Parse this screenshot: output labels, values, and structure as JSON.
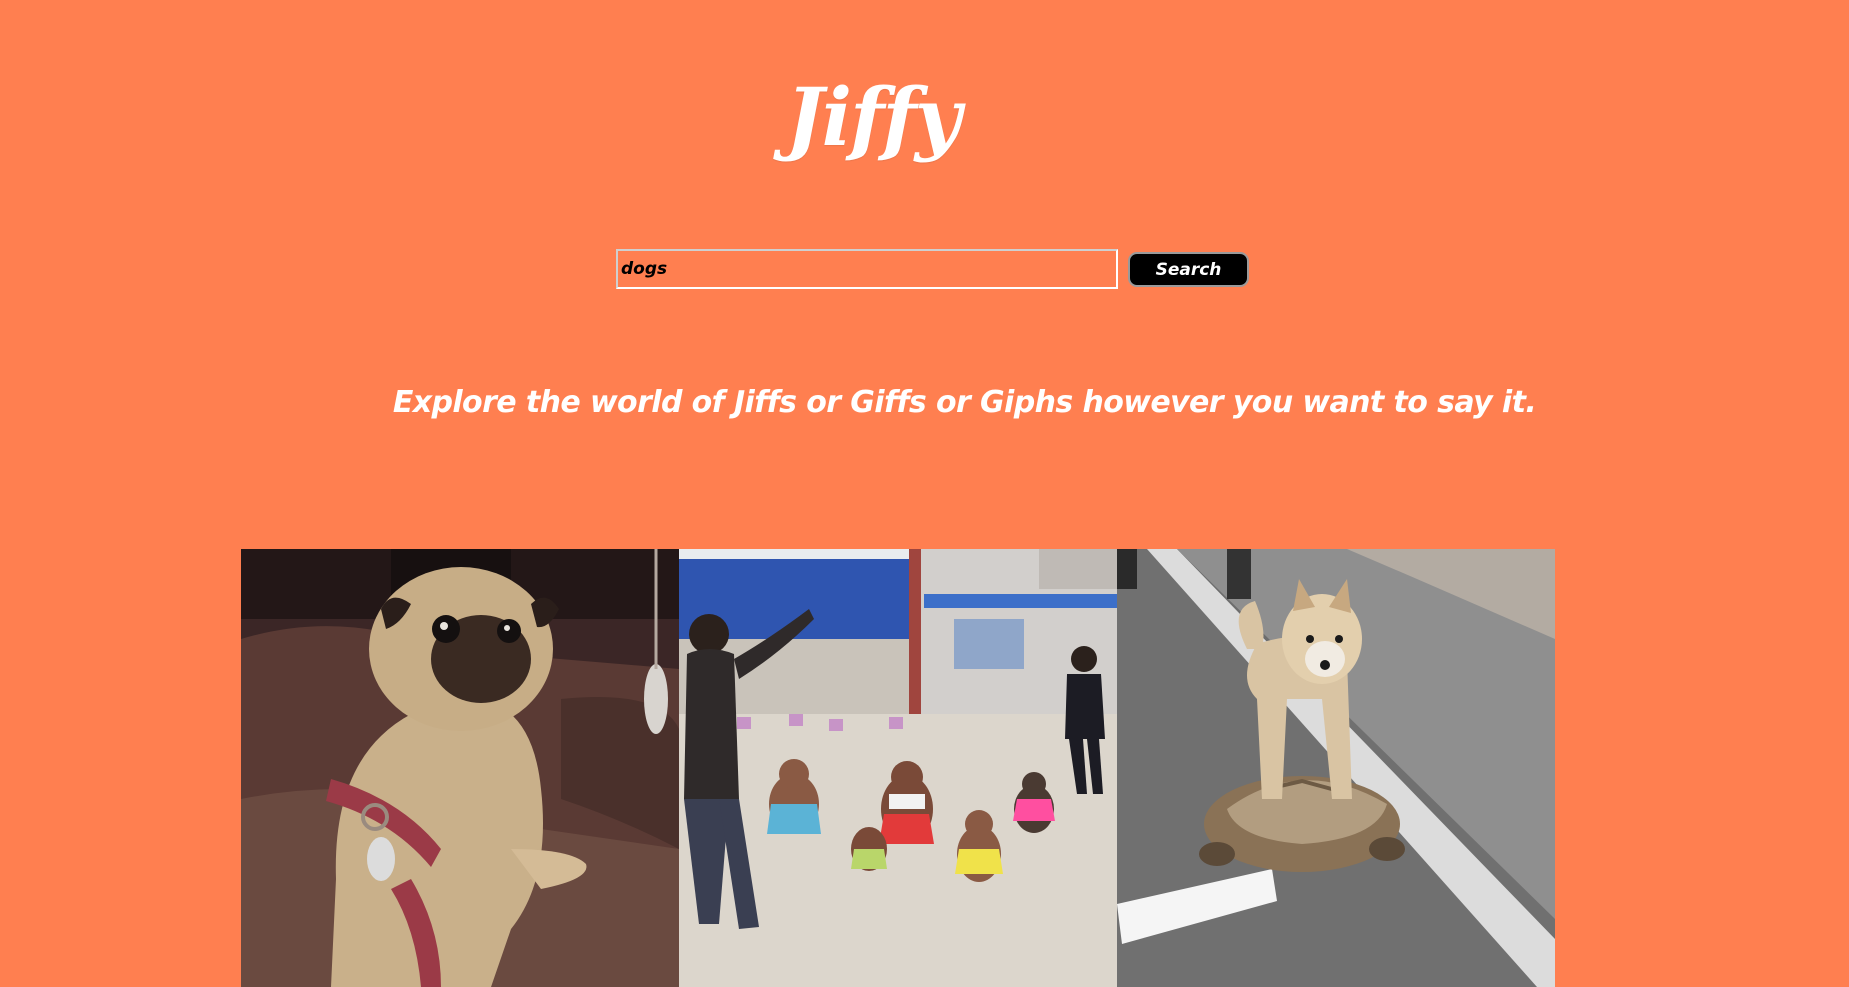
{
  "header": {
    "logo_text": "Jiffy"
  },
  "search": {
    "value": "dogs",
    "button_label": "Search"
  },
  "tagline": "Explore the world of Jiffs or Giffs or Giphs however you want to say it.",
  "gallery": {
    "items": [
      {
        "subject": "pug-on-couch"
      },
      {
        "subject": "dancing-poodles"
      },
      {
        "subject": "shiba-on-tortoise"
      }
    ]
  },
  "colors": {
    "background": "#FF7F50",
    "text": "#FFFFFF",
    "button": "#000000"
  }
}
